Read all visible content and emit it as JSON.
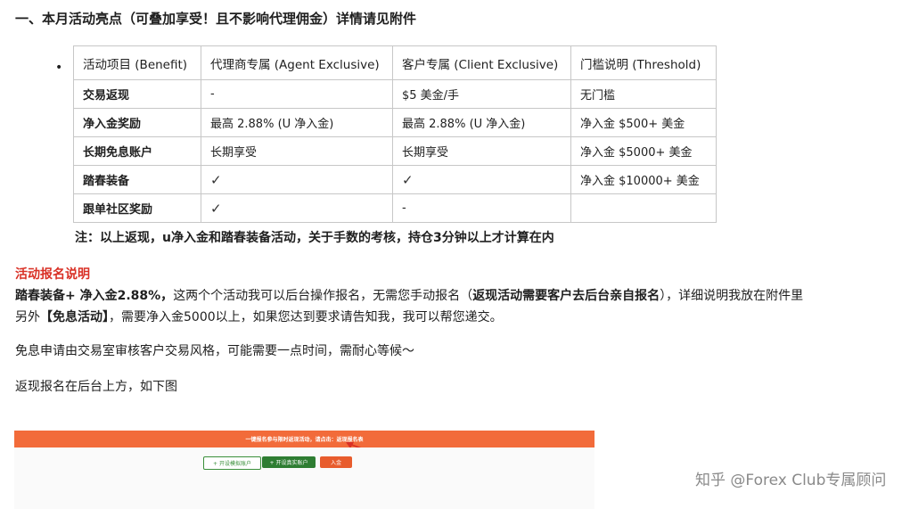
{
  "heading": "一、本月活动亮点（可叠加享受！且不影响代理佣金）详情请见附件",
  "table": {
    "headers": [
      "活动项目 (Benefit)",
      "代理商专属 (Agent Exclusive)",
      "客户专属 (Client Exclusive)",
      "门槛说明 (Threshold)"
    ],
    "rows": [
      [
        "交易返现",
        "-",
        "$5 美金/手",
        "无门槛"
      ],
      [
        "净入金奖励",
        "最高 2.88% (U 净入金)",
        "最高 2.88% (U 净入金)",
        "净入金 $500+ 美金"
      ],
      [
        "长期免息账户",
        "长期享受",
        "长期享受",
        "净入金 $5000+ 美金"
      ],
      [
        "踏春装备",
        "✓",
        "✓",
        "净入金 $10000+ 美金"
      ],
      [
        "跟单社区奖励",
        "✓",
        "-",
        ""
      ]
    ]
  },
  "note": "注：以上返现，u净入金和踏春装备活动，关于手数的考核，持仓3分钟以上才计算在内",
  "section_title": "活动报名说明",
  "para1": {
    "bold1": "踏春装备+ 净入金2.88%，",
    "text1": "这两个个活动我可以后台操作报名，无需您手动报名（",
    "bold2": "返现活动需要客户去后台亲自报名",
    "text2": "），详细说明我放在附件里"
  },
  "para2": {
    "text1": "另外",
    "bold1": "【免息活动】",
    "text2": "，需要净入金5000以上，如果您达到要求请告知我，我可以帮您递交。"
  },
  "para3": "免息申请由交易室审核客户交易风格，可能需要一点时间，需耐心等候～",
  "para4": "返现报名在后台上方，如下图",
  "banner": {
    "text": "一键报名参与限时返现活动，请点击：返现报名表",
    "btn1": "+ 开设模拟账户",
    "btn2": "+ 开设真实账户",
    "btn3": "入金",
    "accent": "#f26b3a"
  },
  "watermark": "知乎 @Forex Club专属顾问"
}
